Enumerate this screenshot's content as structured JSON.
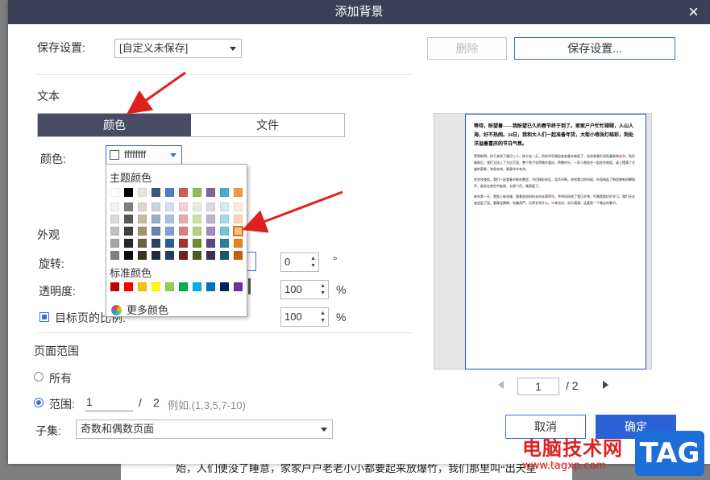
{
  "background_text": "始，人们便没了睡意，家家户户老老小小都要起来放爆竹，我们那里叫“出天星",
  "dialog": {
    "title": "添加背景",
    "close": "×"
  },
  "save_settings": {
    "label": "保存设置:",
    "preset_value": "[自定义未保存]",
    "delete_label": "删除",
    "save_label": "保存设置..."
  },
  "text_section": {
    "title": "文本",
    "tabs": [
      "颜色",
      "文件"
    ],
    "color_label": "颜色:",
    "color_value": "ffffffff"
  },
  "color_popup": {
    "theme_title": "主题颜色",
    "standard_title": "标准颜色",
    "more_colors": "更多颜色",
    "theme_top_row": [
      "#ffffff",
      "#000000",
      "#e8e5dc",
      "#3b5678",
      "#4b7fc3",
      "#d15a57",
      "#97b856",
      "#7f64a2",
      "#48aec4",
      "#f39a43"
    ],
    "theme_columns": [
      [
        "#f2f2f2",
        "#d9d9d9",
        "#bfbfbf",
        "#a6a6a6",
        "#7f7f7f"
      ],
      [
        "#7f7f7f",
        "#595959",
        "#404040",
        "#262626",
        "#0d0d0d"
      ],
      [
        "#dcd8c8",
        "#c3bd9c",
        "#9d9268",
        "#6a6140",
        "#3a3420"
      ],
      [
        "#c7d4e5",
        "#9aaecb",
        "#6b84aa",
        "#2c4061",
        "#1d2b40"
      ],
      [
        "#d3e0f2",
        "#a8c2e5",
        "#7ca2d8",
        "#2d5c9a",
        "#1f3e67"
      ],
      [
        "#f3d3d2",
        "#e8a9a7",
        "#dd7e7b",
        "#a33532",
        "#6c2321"
      ],
      [
        "#e5eed3",
        "#cde0a8",
        "#b3d07c",
        "#6f8c36",
        "#4a5d24"
      ],
      [
        "#dfd8e9",
        "#c0b1d2",
        "#a08bbb",
        "#5c4581",
        "#3d2e56"
      ],
      [
        "#d1ecf2",
        "#a4d9e5",
        "#77c6d8",
        "#2b8196",
        "#1c5664"
      ],
      [
        "#fdeada",
        "#fbd5b5",
        "#f9c08f",
        "#e8821e",
        "#c4620a"
      ]
    ],
    "selected": "#f9c08f",
    "standard_colors": [
      "#c00000",
      "#ff0000",
      "#ffc000",
      "#ffff00",
      "#92d050",
      "#00b050",
      "#00b0f0",
      "#0070c0",
      "#002060",
      "#7030a0"
    ]
  },
  "appearance": {
    "title": "外观",
    "rotation_label": "旋转:",
    "rotation_value": "0",
    "degree_symbol": "°",
    "opacity_label": "透明度:",
    "opacity_value": "100",
    "percent": "%",
    "scale_label": "目标页的比例:",
    "scale_value": "100"
  },
  "page_range": {
    "title": "页面范围",
    "all_label": "所有",
    "range_label": "范围:",
    "range_from": "1",
    "separator": "/",
    "range_total": "2",
    "range_hint": "例如.(1,3,5,7-10)",
    "subset_label": "子集:",
    "subset_value": "奇数和偶数页面"
  },
  "preview": {
    "heading": "等待，盼望着——我盼望已久的春节终于到了。家家户户忙忙碌碌，人山人海，好不热闹。24日，我和大人们一起准备年货，大街小巷张灯结彩，到处洋溢着喜庆的节日气氛。",
    "para1_a": "等啊盼啊，终于来到了腊月三十。除夕这一天，奶奶早早就起来准备年夜饭了，爸爸和我负责贴春联和",
    "para1_red": "福",
    "para1_b": "字。贴好春联后，我们又挂上了大红灯笼，整个院子显得格外喜庆。傍晚时分，一家人围坐在一起吃年夜饭，桌上摆满了丰盛的菜肴，有鱼有肉，寓意年年有余。",
    "para2": "吃完年夜饭，我们一起看春节联欢晚会，节目精彩纷呈，笑声不断。快到零点的时候，外面响起了噼里啪啦的鞭炮声，烟花在夜空中绽放，五颜六色，美丽极了。",
    "para3_a": "新年第一天，我穿上新衣服，跟着爸爸妈妈去给长辈拜年。爷爷奶奶给了我压岁钱，叮嘱我要好好学习。我们还去庙会逛了逛，看舞龙舞狮，吃糖葫芦，玩得非常开心。",
    "para3_red": "年",
    "para3_b": "味浓浓，欢乐满满，这真是一个难忘的春节。",
    "page_current": "1",
    "page_sep": "/ 2"
  },
  "footer": {
    "cancel_label": "取消",
    "ok_label": "确定"
  },
  "watermark": {
    "site_name": "电脑技术网",
    "url": "www.tagxp.com",
    "tag": "TAG"
  }
}
